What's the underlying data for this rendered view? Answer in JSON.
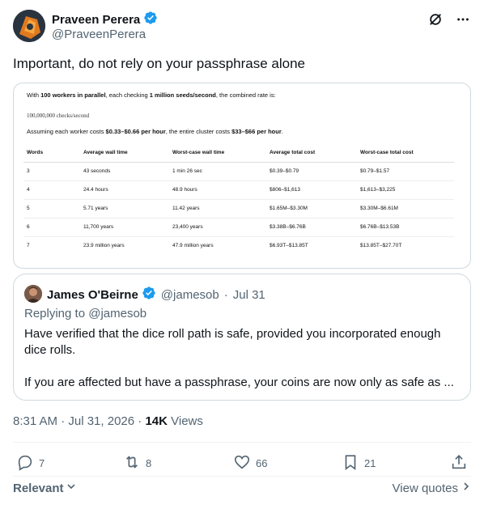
{
  "author": {
    "name": "Praveen Perera",
    "handle": "@PraveenPerera"
  },
  "tweet_text": "Important, do not rely on your passphrase alone",
  "media": {
    "line1_pre": "With ",
    "line1_b1": "100 workers in parallel",
    "line1_mid": ", each checking ",
    "line1_b2": "1 million seeds/second",
    "line1_post": ", the combined rate is:",
    "rate": "100,000,000 checks/second",
    "line3_pre": "Assuming each worker costs ",
    "line3_b1": "$0.33–$0.66 per hour",
    "line3_mid": ", the entire cluster costs ",
    "line3_b2": "$33–$66 per hour",
    "line3_post": ".",
    "table": {
      "headers": [
        "Words",
        "Average wall time",
        "Worst-case wall time",
        "Average total cost",
        "Worst-case total cost"
      ],
      "rows": [
        [
          "3",
          "43 seconds",
          "1 min 26 sec",
          "$0.39–$0.79",
          "$0.79–$1.57"
        ],
        [
          "4",
          "24.4 hours",
          "48.9 hours",
          "$806–$1,613",
          "$1,613–$3,225"
        ],
        [
          "5",
          "5.71 years",
          "11.42 years",
          "$1.65M–$3.30M",
          "$3.30M–$6.61M"
        ],
        [
          "6",
          "11,700 years",
          "23,400 years",
          "$3.38B–$6.76B",
          "$6.76B–$13.53B"
        ],
        [
          "7",
          "23.9 million years",
          "47.9 million years",
          "$6.93T–$13.85T",
          "$13.85T–$27.70T"
        ]
      ]
    }
  },
  "quote": {
    "name": "James O'Beirne",
    "handle": "@jamesob",
    "sep": "·",
    "date": "Jul 31",
    "replying": "Replying to @jamesob",
    "p1": "Have verified that the dice roll path is safe, provided you incorporated enough dice rolls.",
    "p2": "If you are affected but have a passphrase, your coins are now only as safe as ..."
  },
  "timestamp": {
    "time": "8:31 AM · Jul 31, 2026 · ",
    "views_count": "14K",
    "views_label": " Views"
  },
  "actions": {
    "replies": "7",
    "reposts": "8",
    "likes": "66",
    "bookmarks": "21"
  },
  "footer": {
    "sort_label": "Relevant",
    "view_quotes": "View quotes"
  },
  "colors": {
    "verified": "#1d9bf0",
    "secondary_text": "#536471",
    "border": "#cfd9de"
  },
  "icons": [
    "verified-badge-icon",
    "grok-icon",
    "more-icon",
    "reply-icon",
    "repost-icon",
    "like-icon",
    "bookmark-icon",
    "share-icon",
    "chevron-down-icon",
    "chevron-right-icon"
  ]
}
